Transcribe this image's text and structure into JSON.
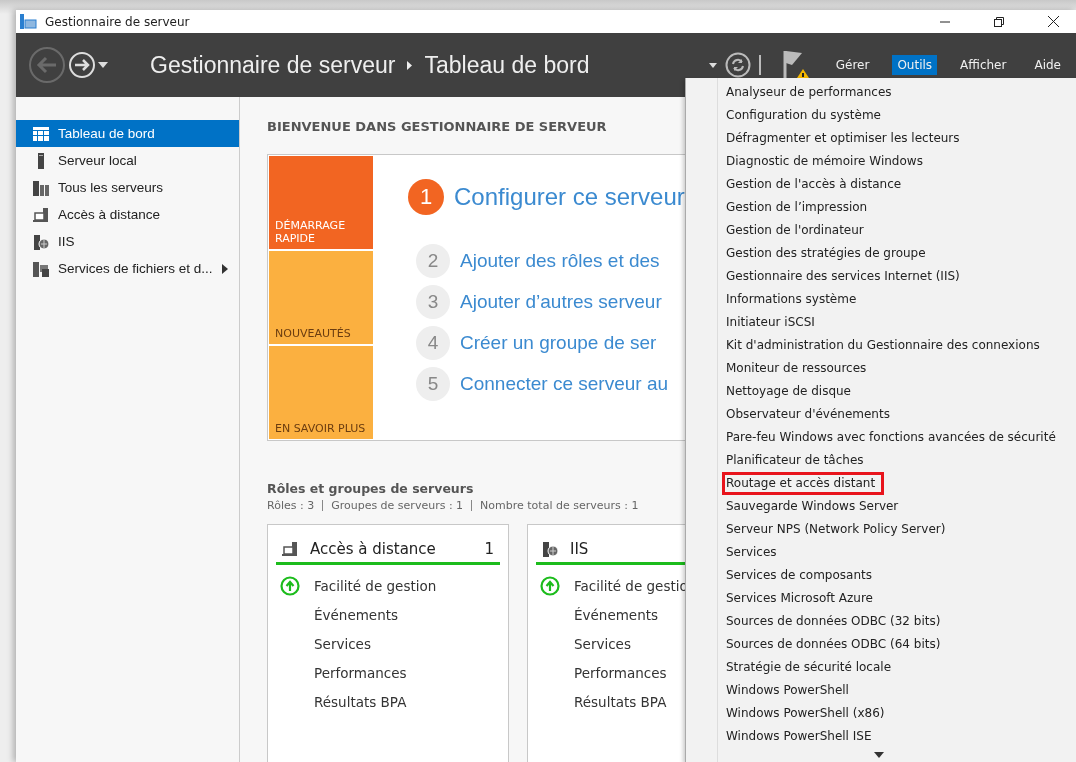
{
  "window": {
    "title": "Gestionnaire de serveur"
  },
  "header": {
    "app": "Gestionnaire de serveur",
    "page": "Tableau de bord",
    "menus": [
      {
        "label": "Gérer",
        "selected": false
      },
      {
        "label": "Outils",
        "selected": true
      },
      {
        "label": "Afficher",
        "selected": false
      },
      {
        "label": "Aide",
        "selected": false
      }
    ]
  },
  "sidebar": {
    "items": [
      {
        "label": "Tableau de bord",
        "kind": "dashboard",
        "selected": true,
        "submenu": false
      },
      {
        "label": "Serveur local",
        "kind": "server",
        "selected": false,
        "submenu": false
      },
      {
        "label": "Tous les serveurs",
        "kind": "servers",
        "selected": false,
        "submenu": false
      },
      {
        "label": "Accès à distance",
        "kind": "remote",
        "selected": false,
        "submenu": false
      },
      {
        "label": "IIS",
        "kind": "iis",
        "selected": false,
        "submenu": false
      },
      {
        "label": "Services de fichiers et d...",
        "kind": "files",
        "selected": false,
        "submenu": true
      }
    ]
  },
  "welcome": {
    "heading": "BIENVENUE DANS GESTIONNAIRE DE SERVEUR",
    "tiles": [
      {
        "label": "DÉMARRAGE RAPIDE",
        "selected": true
      },
      {
        "label": "NOUVEAUTÉS",
        "selected": false
      },
      {
        "label": "EN SAVOIR PLUS",
        "selected": false
      }
    ],
    "steps": [
      {
        "number": "1",
        "label": "Configurer ce serveur",
        "selected": true
      },
      {
        "number": "2",
        "label": "Ajouter des rôles et des",
        "selected": false
      },
      {
        "number": "3",
        "label": "Ajouter d’autres serveur",
        "selected": false
      },
      {
        "number": "4",
        "label": "Créer un groupe de ser",
        "selected": false
      },
      {
        "number": "5",
        "label": "Connecter ce serveur au",
        "selected": false
      }
    ]
  },
  "roles": {
    "heading": "Rôles et groupes de serveurs",
    "stats": [
      "Rôles : 3",
      "Groupes de serveurs : 1",
      "Nombre total de serveurs : 1"
    ],
    "cards": [
      {
        "title": "Accès à distance",
        "kind": "remote",
        "count": "1",
        "rows": [
          {
            "label": "Facilité de gestion",
            "kind": "status"
          },
          {
            "label": "Événements",
            "kind": "plain"
          },
          {
            "label": "Services",
            "kind": "plain"
          },
          {
            "label": "Performances",
            "kind": "plain"
          },
          {
            "label": "Résultats BPA",
            "kind": "plain"
          }
        ]
      },
      {
        "title": "IIS",
        "kind": "iis",
        "rows": [
          {
            "label": "Facilité de gestio",
            "kind": "status"
          },
          {
            "label": "Événements",
            "kind": "plain"
          },
          {
            "label": "Services",
            "kind": "plain"
          },
          {
            "label": "Performances",
            "kind": "plain"
          },
          {
            "label": "Résultats BPA",
            "kind": "plain"
          }
        ]
      }
    ]
  },
  "tools_menu": {
    "items": [
      {
        "label": "Analyseur de performances",
        "highlighted": false
      },
      {
        "label": "Configuration du système",
        "highlighted": false
      },
      {
        "label": "Défragmenter et optimiser les lecteurs",
        "highlighted": false
      },
      {
        "label": "Diagnostic de mémoire Windows",
        "highlighted": false
      },
      {
        "label": "Gestion de l'accès à distance",
        "highlighted": false
      },
      {
        "label": "Gestion de l’impression",
        "highlighted": false
      },
      {
        "label": "Gestion de l'ordinateur",
        "highlighted": false
      },
      {
        "label": "Gestion des stratégies de groupe",
        "highlighted": false
      },
      {
        "label": "Gestionnaire des services Internet (IIS)",
        "highlighted": false
      },
      {
        "label": "Informations système",
        "highlighted": false
      },
      {
        "label": "Initiateur iSCSI",
        "highlighted": false
      },
      {
        "label": "Kit d'administration du Gestionnaire des connexions",
        "highlighted": false
      },
      {
        "label": "Moniteur de ressources",
        "highlighted": false
      },
      {
        "label": "Nettoyage de disque",
        "highlighted": false
      },
      {
        "label": "Observateur d'événements",
        "highlighted": false
      },
      {
        "label": "Pare-feu Windows avec fonctions avancées de sécurité",
        "highlighted": false
      },
      {
        "label": "Planificateur de tâches",
        "highlighted": false
      },
      {
        "label": "Routage et accès distant",
        "highlighted": true
      },
      {
        "label": "Sauvegarde Windows Server",
        "highlighted": false
      },
      {
        "label": "Serveur NPS (Network Policy Server)",
        "highlighted": false
      },
      {
        "label": "Services",
        "highlighted": false
      },
      {
        "label": "Services de composants",
        "highlighted": false
      },
      {
        "label": "Services Microsoft Azure",
        "highlighted": false
      },
      {
        "label": "Sources de données ODBC (32 bits)",
        "highlighted": false
      },
      {
        "label": "Sources de données ODBC (64 bits)",
        "highlighted": false
      },
      {
        "label": "Stratégie de sécurité locale",
        "highlighted": false
      },
      {
        "label": "Windows PowerShell",
        "highlighted": false
      },
      {
        "label": "Windows PowerShell (x86)",
        "highlighted": false
      },
      {
        "label": "Windows PowerShell ISE",
        "highlighted": false
      }
    ]
  }
}
